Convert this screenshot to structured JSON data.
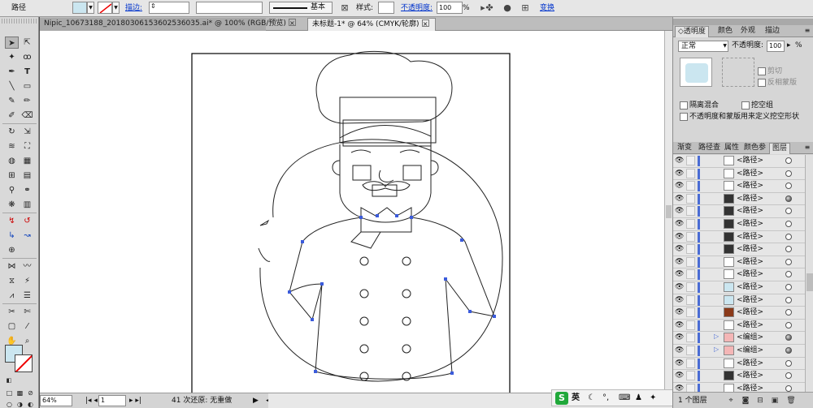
{
  "control_bar": {
    "object_type": "路径",
    "stroke_link": "描边:",
    "stroke_style_name": "基本",
    "style_label": "样式:",
    "opacity_link": "不透明度:",
    "opacity_value": "100",
    "opacity_unit": "%",
    "transform_link": "变换"
  },
  "doc_tabs": [
    {
      "label": "Nipic_10673188_20180306153602536035.ai* @ 100% (RGB/预览)"
    },
    {
      "label": "未标题-1* @ 64% (CMYK/轮廓)"
    }
  ],
  "transparency_panel": {
    "tabs": [
      "◇透明度",
      "颜色",
      "外观",
      "描边"
    ],
    "blend_mode": "正常",
    "opacity_label": "不透明度:",
    "opacity_value": "100",
    "opacity_unit": "%",
    "clip_label": "剪切",
    "invert_mask_label": "反相蒙版",
    "isolate_blending": "隔离混合",
    "knockout_group": "挖空组",
    "define_knockout": "不透明度和蒙版用来定义挖空形状"
  },
  "layers_panel": {
    "tabs": [
      "渐变",
      "路径查",
      "属性",
      "颜色参",
      "图层"
    ],
    "items": [
      {
        "name": "<路径>",
        "thumb": "#ffffff",
        "target": "open"
      },
      {
        "name": "<路径>",
        "thumb": "#ffffff",
        "target": "open"
      },
      {
        "name": "<路径>",
        "thumb": "#ffffff",
        "target": "open"
      },
      {
        "name": "<路径>",
        "thumb": "#333333",
        "target": "filled"
      },
      {
        "name": "<路径>",
        "thumb": "#333333",
        "target": "open"
      },
      {
        "name": "<路径>",
        "thumb": "#333333",
        "target": "open"
      },
      {
        "name": "<路径>",
        "thumb": "#333333",
        "target": "open"
      },
      {
        "name": "<路径>",
        "thumb": "#333333",
        "target": "open"
      },
      {
        "name": "<路径>",
        "thumb": "#ffffff",
        "target": "open"
      },
      {
        "name": "<路径>",
        "thumb": "#ffffff",
        "target": "open"
      },
      {
        "name": "<路径>",
        "thumb": "#cbe6f0",
        "target": "open"
      },
      {
        "name": "<路径>",
        "thumb": "#cbe6f0",
        "target": "open"
      },
      {
        "name": "<路径>",
        "thumb": "#8b3a1a",
        "target": "open"
      },
      {
        "name": "<路径>",
        "thumb": "#ffffff",
        "target": "open"
      },
      {
        "name": "<编组>",
        "thumb": "#f4b6b6",
        "target": "filled",
        "group": true
      },
      {
        "name": "<编组>",
        "thumb": "#f4b6b6",
        "target": "filled",
        "group": true
      },
      {
        "name": "<路径>",
        "thumb": "#ffffff",
        "target": "open"
      },
      {
        "name": "<路径>",
        "thumb": "#333333",
        "target": "open"
      },
      {
        "name": "<路径>",
        "thumb": "#ffffff",
        "target": "open"
      }
    ],
    "footer_count": "1 个图层"
  },
  "status_bar": {
    "zoom": "64%",
    "page": "1",
    "undo_info": "41 次还原: 无重做"
  },
  "ime": {
    "logo": "S",
    "mode": "英"
  },
  "colors": {
    "fill": "#cbe6f0",
    "accent_link": "#0033cc",
    "anchor_blue": "#3b5bdb"
  }
}
